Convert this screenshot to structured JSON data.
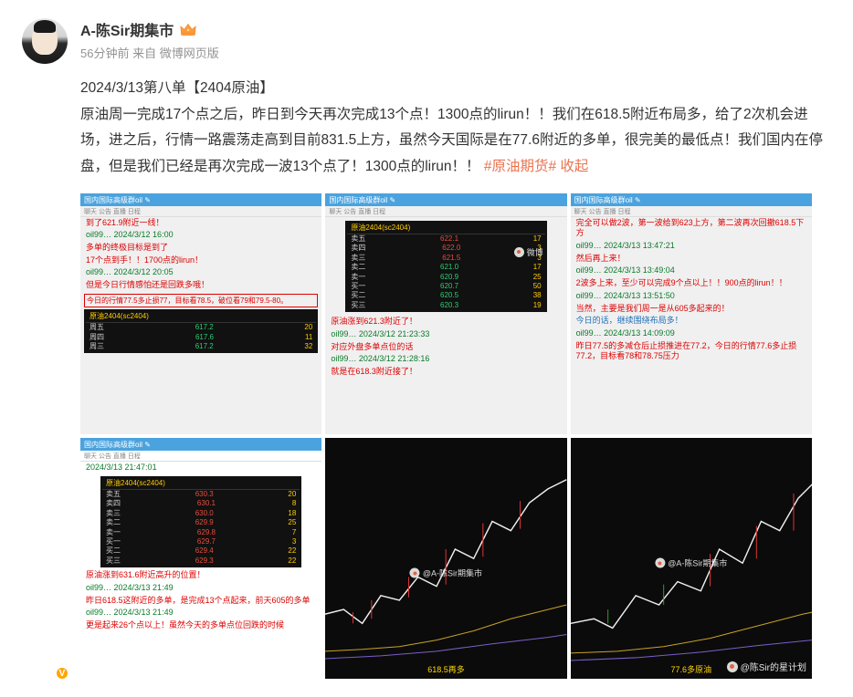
{
  "user": {
    "name": "A-陈Sir期集市",
    "verified": true
  },
  "meta": {
    "time": "56分钟前",
    "from_prefix": "来自",
    "source": "微博网页版"
  },
  "post": {
    "title": "2024/3/13第八单【2404原油】",
    "body": "原油周一完成17个点之后，昨日到今天再次完成13个点！1300点的lirun！！我们在618.5附近布局多，给了2次机会进场，进之后，行情一路震荡走高到目前831.5上方，虽然今天国际是在77.6附近的多单，很完美的最低点！我们国内在停盘，但是我们已经是再次完成一波13个点了！1300点的lirun！！",
    "hashtag": "#原油期货#",
    "collapse": "收起"
  },
  "thumbs": {
    "t1": {
      "header": "国内国际高级群oil ✎",
      "tabs": "聊天  公告  直播  日程",
      "lines": [
        {
          "cls": "t-red",
          "txt": "到了621.9附近一线！"
        },
        {
          "cls": "t-green",
          "txt": "oil99… 2024/3/12 16:00"
        },
        {
          "cls": "t-red",
          "txt": "多单的终极目标是到了"
        },
        {
          "cls": "t-red",
          "txt": "17个点到手！！1700点的lirun！"
        },
        {
          "cls": "t-green",
          "txt": "oil99… 2024/3/12 20:05"
        },
        {
          "cls": "t-red",
          "txt": "但是今日行情感怕还是回跌多哦！"
        }
      ],
      "boxed": "今日的行情77.5多止损77，目标看78.5，破位看79和79.5-80。",
      "dark_hdr": "原油2404(sc2404)",
      "dark_rows": [
        [
          "周五",
          "617.2",
          "20"
        ],
        [
          "周四",
          "617.6",
          "11"
        ],
        [
          "周三",
          "617.2",
          "32"
        ]
      ]
    },
    "t2": {
      "header": "国内国际高级群oil ✎",
      "tabs": "聊天  公告  直播  日程",
      "dark_hdr": "原油2404(sc2404)",
      "dark_rows": [
        [
          "卖五",
          "622.1",
          "17"
        ],
        [
          "卖四",
          "622.0",
          "3"
        ],
        [
          "卖三",
          "621.5",
          "3"
        ],
        [
          "卖二",
          "621.0",
          "17"
        ],
        [
          "卖一",
          "620.9",
          "25"
        ],
        [
          "买一",
          "620.7",
          "50"
        ],
        [
          "买二",
          "620.5",
          "38"
        ],
        [
          "买三",
          "620.3",
          "19"
        ]
      ],
      "lines": [
        {
          "cls": "t-red",
          "txt": "原油涨到621.3附近了！"
        },
        {
          "cls": "t-green",
          "txt": "oil99… 2024/3/12 21:23:33"
        },
        {
          "cls": "t-red",
          "txt": "对应外盘多单点位的话"
        },
        {
          "cls": "t-green",
          "txt": "oil99… 2024/3/12 21:28:16"
        },
        {
          "cls": "t-red",
          "txt": "就是在618.3附近接了！"
        }
      ]
    },
    "t3": {
      "header": "国内国际高级群oil ✎",
      "tabs": "聊天  公告  直播  日程",
      "lines": [
        {
          "cls": "t-red",
          "txt": "完全可以做2波，第一波给到623上方，第二波再次回撤618.5下方"
        },
        {
          "cls": "t-green",
          "txt": "oil99… 2024/3/13 13:47:21"
        },
        {
          "cls": "t-red",
          "txt": "然后再上来！"
        },
        {
          "cls": "t-green",
          "txt": "oil99… 2024/3/13 13:49:04"
        },
        {
          "cls": "t-red",
          "txt": "2波多上来，至少可以完成9个点以上！！900点的lirun！！"
        },
        {
          "cls": "t-green",
          "txt": "oil99… 2024/3/13 13:51:50"
        },
        {
          "cls": "t-red",
          "txt": "当然，主要是我们周一是从605多起来的！"
        },
        {
          "cls": "t-blue",
          "txt": "今日的话，继续围绕布局多！"
        },
        {
          "cls": "t-green",
          "txt": "oil99… 2024/3/13 14:09:09"
        },
        {
          "cls": "t-red",
          "txt": "昨日77.5的多减仓后止损推进在77.2，今日的行情77.6多止损77.2，目标看78和78.75压力"
        }
      ]
    },
    "t4": {
      "header": "国内国际高级群oil ✎",
      "tabs": "聊天  公告  直播  日程",
      "date": "2024/3/13 21:47:01",
      "dark_hdr": "原油2404(sc2404)",
      "dark_rows": [
        [
          "卖五",
          "630.3",
          "20"
        ],
        [
          "卖四",
          "630.1",
          "8"
        ],
        [
          "卖三",
          "630.0",
          "18"
        ],
        [
          "卖二",
          "629.9",
          "25"
        ],
        [
          "卖一",
          "629.8",
          "7"
        ],
        [
          "买一",
          "629.7",
          "3"
        ],
        [
          "买二",
          "629.4",
          "22"
        ],
        [
          "买三",
          "629.3",
          "22"
        ]
      ],
      "lines": [
        {
          "cls": "t-red",
          "txt": "原油涨到631.6附近高升的位置！"
        },
        {
          "cls": "t-green",
          "txt": "oil99… 2024/3/13 21:49"
        },
        {
          "cls": "t-red",
          "txt": "昨日618.5这附近的多单，是完成13个点起来，前天605的多单"
        },
        {
          "cls": "t-green",
          "txt": "oil99… 2024/3/13 21:49"
        },
        {
          "cls": "t-red",
          "txt": "更是起来26个点以上！虽然今天的多单点位回跌的时候"
        }
      ]
    },
    "t5": {
      "watermark": "@A-陈Sir期集市",
      "caption": "618.5再多"
    },
    "t6": {
      "watermark": "@A-陈Sir期集市",
      "caption": "77.6多原油"
    }
  },
  "footer_watermark": "@陈Sir的星计划"
}
